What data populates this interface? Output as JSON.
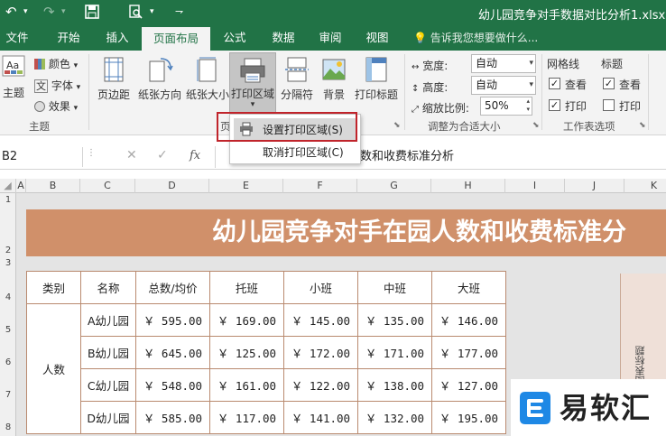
{
  "window": {
    "title": "幼儿园竞争对手数据对比分析1.xlsx - Ex"
  },
  "tabs": [
    {
      "label": "文件"
    },
    {
      "label": "开始"
    },
    {
      "label": "插入"
    },
    {
      "label": "页面布局"
    },
    {
      "label": "公式"
    },
    {
      "label": "数据"
    },
    {
      "label": "审阅"
    },
    {
      "label": "视图"
    }
  ],
  "tell_me": "告诉我您想要做什么...",
  "ribbon": {
    "theme": {
      "label": "主题",
      "colors": "颜色",
      "fonts": "字体",
      "effects": "效果",
      "group": "主题"
    },
    "page_setup": {
      "margins": "页边距",
      "orientation": "纸张方向",
      "size": "纸张大小",
      "print_area": "打印区域",
      "breaks": "分隔符",
      "background": "背景",
      "print_titles": "打印标题",
      "group_visible": "页"
    },
    "scale": {
      "width_label": "宽度:",
      "width_value": "自动",
      "height_label": "高度:",
      "height_value": "自动",
      "scale_label": "缩放比例:",
      "scale_value": "50%",
      "group": "调整为合适大小"
    },
    "sheet_options": {
      "gridlines": "网格线",
      "headings": "标题",
      "view": "查看",
      "print": "打印",
      "view2": "查看",
      "print2": "打印",
      "group": "工作表选项"
    }
  },
  "menu": {
    "set_print_area": "设置打印区域(S)",
    "clear_print_area": "取消打印区域(C)"
  },
  "formula_bar": {
    "name_box": "B2",
    "fx": "fx",
    "content": "数和收费标准分析"
  },
  "columns": [
    "A",
    "B",
    "C",
    "D",
    "E",
    "F",
    "G",
    "H",
    "I",
    "J",
    "K"
  ],
  "rows": [
    "1",
    "2",
    "3",
    "4",
    "5",
    "6",
    "7",
    "8"
  ],
  "sheet": {
    "banner": "幼儿园竞争对手在园人数和收费标准分",
    "headers": [
      "类别",
      "名称",
      "总数/均价",
      "托班",
      "小班",
      "中班",
      "大班"
    ],
    "category": "人数",
    "data": [
      [
        "A幼儿园",
        "￥ 595.00",
        "￥ 169.00",
        "￥ 145.00",
        "￥ 135.00",
        "￥ 146.00"
      ],
      [
        "B幼儿园",
        "￥ 645.00",
        "￥ 125.00",
        "￥ 172.00",
        "￥ 171.00",
        "￥ 177.00"
      ],
      [
        "C幼儿园",
        "￥ 548.00",
        "￥ 161.00",
        "￥ 122.00",
        "￥ 138.00",
        "￥ 127.00"
      ],
      [
        "D幼儿园",
        "￥ 585.00",
        "￥ 117.00",
        "￥ 141.00",
        "￥ 132.00",
        "￥ 195.00"
      ]
    ],
    "side_label": "图表标题"
  },
  "watermark": {
    "text": "易软汇"
  },
  "colors": {
    "excel_green": "#217346",
    "banner": "#d0906a",
    "highlight": "#c0242b"
  }
}
